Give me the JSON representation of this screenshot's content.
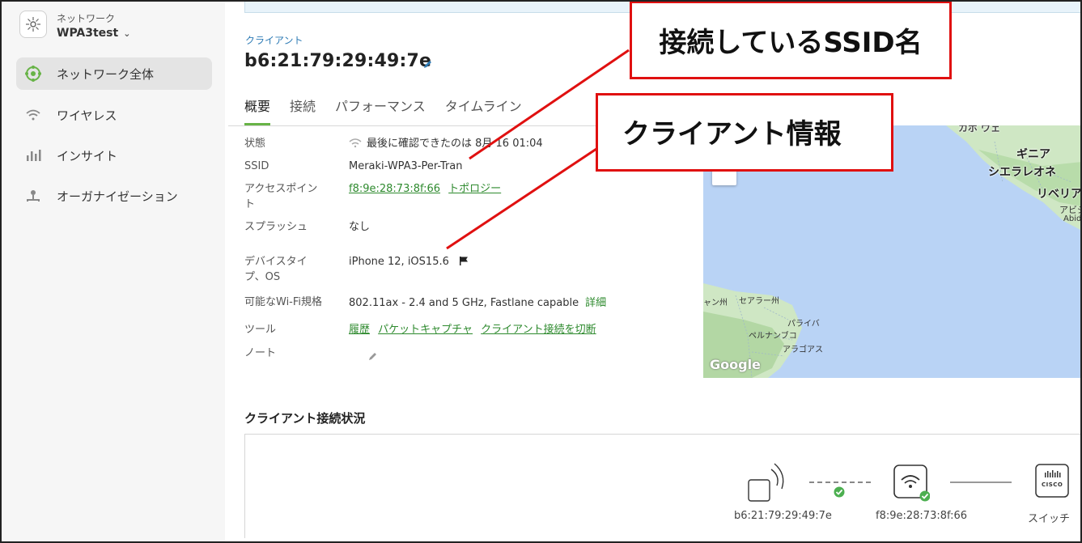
{
  "sidebar": {
    "network_label": "ネットワーク",
    "network_name": "WPA3test",
    "items": [
      {
        "label": "ネットワーク全体",
        "icon": "network-icon",
        "active": true
      },
      {
        "label": "ワイヤレス",
        "icon": "wifi-icon"
      },
      {
        "label": "インサイト",
        "icon": "bar-chart-icon"
      },
      {
        "label": "オーガナイゼーション",
        "icon": "organization-icon"
      }
    ]
  },
  "header": {
    "breadcrumb": "クライアント",
    "title": "b6:21:79:29:49:7e"
  },
  "tabs": [
    "概要",
    "接続",
    "パフォーマンス",
    "タイムライン"
  ],
  "details": {
    "status_label": "状態",
    "status_value": "最後に確認できたのは 8月 16 01:04",
    "ssid_label": "SSID",
    "ssid_value": "Meraki-WPA3-Per-Tran",
    "ap_label_1": "アクセスポイン",
    "ap_label_2": "ト",
    "ap_value": "f8:9e:28:73:8f:66",
    "ap_topology": "トポロジー",
    "splash_label": "スプラッシュ",
    "splash_value": "なし",
    "device_label_1": "デバイスタイ",
    "device_label_2": "プ、OS",
    "device_value": "iPhone 12, iOS15.6",
    "wifi_label": "可能なWi-Fi規格",
    "wifi_value": "802.11ax - 2.4 and 5 GHz, Fastlane capable",
    "wifi_detail": "詳細",
    "tools_label": "ツール",
    "tool_history": "履歴",
    "tool_capture": "パケットキャプチャ",
    "tool_disconnect": "クライアント接続を切断",
    "note_label": "ノート"
  },
  "map": {
    "zoom_in": "+",
    "zoom_out": "−",
    "labels": [
      "ギニア",
      "シエラレオネ",
      "リベリア",
      "アビジ",
      "Abid",
      "セアラー州",
      "ャン州",
      "パライバ",
      "ペルナンブコ",
      "アラゴアス"
    ],
    "attribution": "Google"
  },
  "connection": {
    "title": "クライアント接続状況",
    "client_label": "b6:21:79:29:49:7e",
    "ap_label": "f8:9e:28:73:8f:66",
    "switch_label": "スイッチ",
    "cisco_text": "CISCO"
  },
  "annotations": {
    "ssid_note": "接続しているSSID名",
    "client_note": "クライアント情報"
  },
  "colors": {
    "accent_green": "#67b346",
    "link_green": "#2e8a2e",
    "annotation_red": "#e01010",
    "map_water": "#b9d3f5"
  }
}
